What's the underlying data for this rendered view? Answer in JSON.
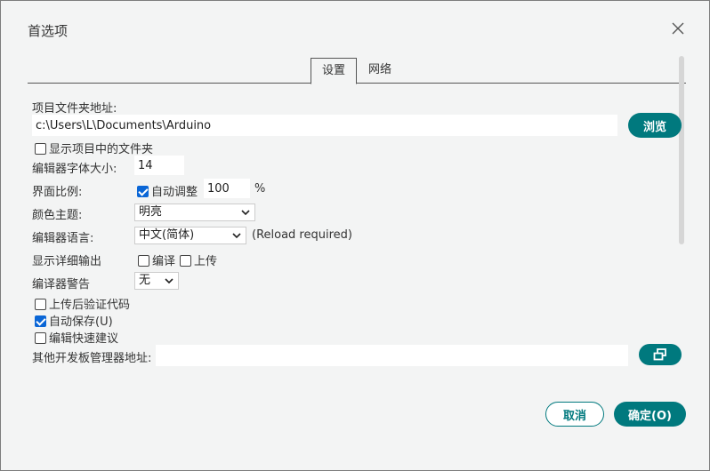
{
  "dialog": {
    "title": "首选项",
    "tabs": [
      {
        "label": "设置",
        "active": true
      },
      {
        "label": "网络",
        "active": false
      }
    ]
  },
  "settings": {
    "sketchbook_label": "项目文件夹地址:",
    "sketchbook_path": "c:\\Users\\L\\Documents\\Arduino",
    "browse_label": "浏览",
    "show_files_label": "显示项目中的文件夹",
    "show_files_checked": false,
    "font_size_label": "编辑器字体大小:",
    "font_size_value": "14",
    "scale_label": "界面比例:",
    "auto_scale_label": "自动调整",
    "auto_scale_checked": true,
    "scale_value": "100",
    "scale_unit": "%",
    "theme_label": "颜色主题:",
    "theme_value": "明亮",
    "language_label": "编辑器语言:",
    "language_value": "中文(简体)",
    "language_note": "(Reload required)",
    "verbose_label": "显示详细输出",
    "verbose_compile_label": "编译",
    "verbose_compile_checked": false,
    "verbose_upload_label": "上传",
    "verbose_upload_checked": false,
    "warnings_label": "编译器警告",
    "warnings_value": "无",
    "verify_label": "上传后验证代码",
    "verify_checked": false,
    "autosave_label": "自动保存(U)",
    "autosave_checked": true,
    "quick_suggest_label": "编辑快速建议",
    "quick_suggest_checked": false,
    "board_urls_label": "其他开发板管理器地址:",
    "board_urls_value": ""
  },
  "footer": {
    "cancel_label": "取消",
    "ok_label": "确定(O)"
  },
  "colors": {
    "accent": "#00797e",
    "checkbox_on": "#0a66d6",
    "background": "#f3f4f4"
  },
  "icons": {
    "close": "close-icon",
    "external_window": "open-window-icon",
    "chevron": "chevron-down-icon"
  }
}
